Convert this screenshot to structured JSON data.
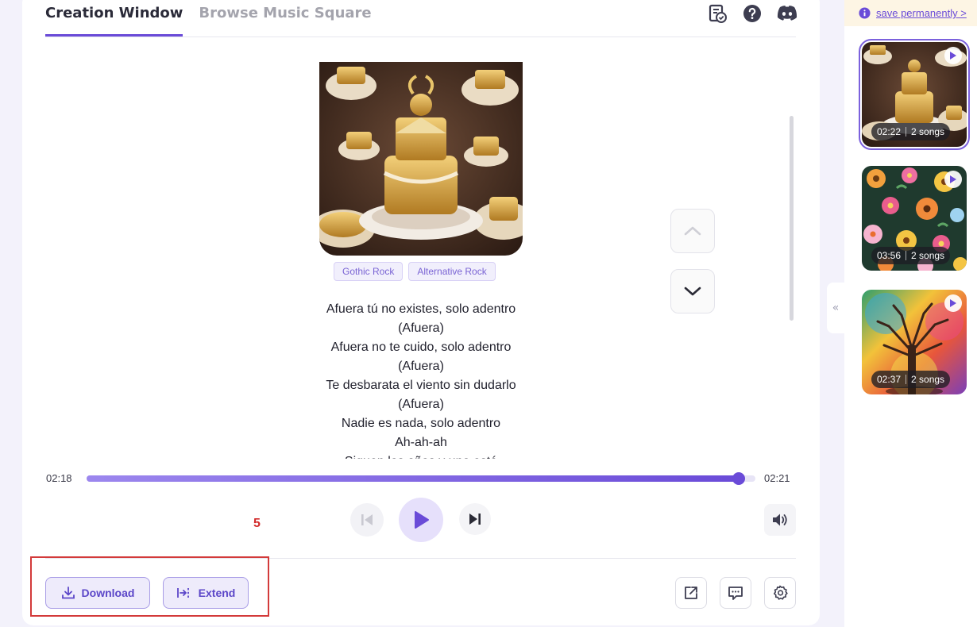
{
  "tabs": [
    {
      "label": "Creation Window",
      "active": true
    },
    {
      "label": "Browse Music Square",
      "active": false
    }
  ],
  "top_icons": [
    "checklist-icon",
    "help-icon",
    "discord-icon"
  ],
  "song": {
    "tags": [
      "Gothic Rock",
      "Alternative Rock"
    ],
    "lyrics": [
      "Afuera tú no existes, solo adentro",
      "(Afuera)",
      "Afuera no te cuido, solo adentro",
      "(Afuera)",
      "Te desbarata el viento sin dudarlo",
      "(Afuera)",
      "Nadie es nada, solo adentro",
      "Ah-ah-ah",
      "Siguen los años y uno está"
    ]
  },
  "player": {
    "current_time": "02:18",
    "total_time": "02:21",
    "progress": 0.975
  },
  "annotation_marker": "5",
  "actions": {
    "download_label": "Download",
    "extend_label": "Extend"
  },
  "right_panel": {
    "banner_link": "save permanently >",
    "items": [
      {
        "duration": "02:22",
        "songs": "2 songs",
        "selected": true
      },
      {
        "duration": "03:56",
        "songs": "2 songs",
        "selected": false
      },
      {
        "duration": "02:37",
        "songs": "2 songs",
        "selected": false
      }
    ]
  },
  "colors": {
    "accent": "#6a4bd8",
    "highlight_box": "#d33a3a",
    "banner_bg": "#fdf5e4"
  }
}
